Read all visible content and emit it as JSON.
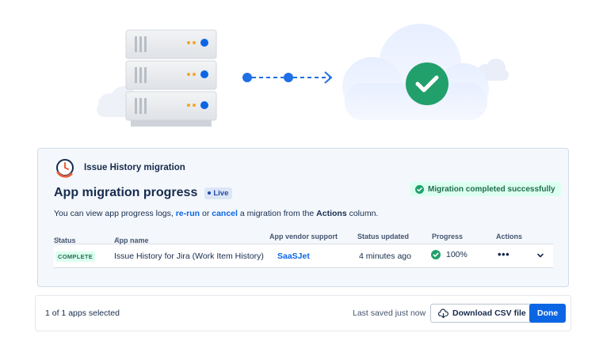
{
  "illustration": {
    "server_icon": "server-rack-icon",
    "cloud_icon": "cloud-icon",
    "check_icon": "check-circle-icon",
    "arrow_icon": "dashed-arrow-icon"
  },
  "panel": {
    "app_logo_icon": "clock-history-icon",
    "app_title": "Issue History migration",
    "page_title": "App migration progress",
    "live_badge": "Live",
    "success_banner": "Migration completed successfully",
    "description": {
      "prefix": "You can view app progress logs, ",
      "rerun_link": "re-run",
      "middle": " or ",
      "cancel_link": "cancel",
      "suffix_pre": " a migration from the ",
      "actions_bold": "Actions",
      "suffix": " column."
    },
    "table": {
      "headers": {
        "status": "Status",
        "app_name": "App name",
        "vendor_support": "App vendor support",
        "status_updated": "Status updated",
        "progress": "Progress",
        "actions": "Actions"
      },
      "rows": [
        {
          "status": "COMPLETE",
          "app_name": "Issue History for Jira (Work Item History)",
          "vendor": "SaaSJet",
          "updated": "4 minutes ago",
          "progress": "100%",
          "actions_label": "•••"
        }
      ]
    }
  },
  "footer": {
    "selected": "1 of 1 apps selected",
    "saved": "Last saved just now",
    "download_csv": "Download CSV file",
    "done": "Done"
  },
  "colors": {
    "primary": "#0c66e4",
    "success": "#22a06b",
    "success_bg": "#dcfff1",
    "server_orange": "#f5a623",
    "server_blue": "#0c66e4"
  }
}
